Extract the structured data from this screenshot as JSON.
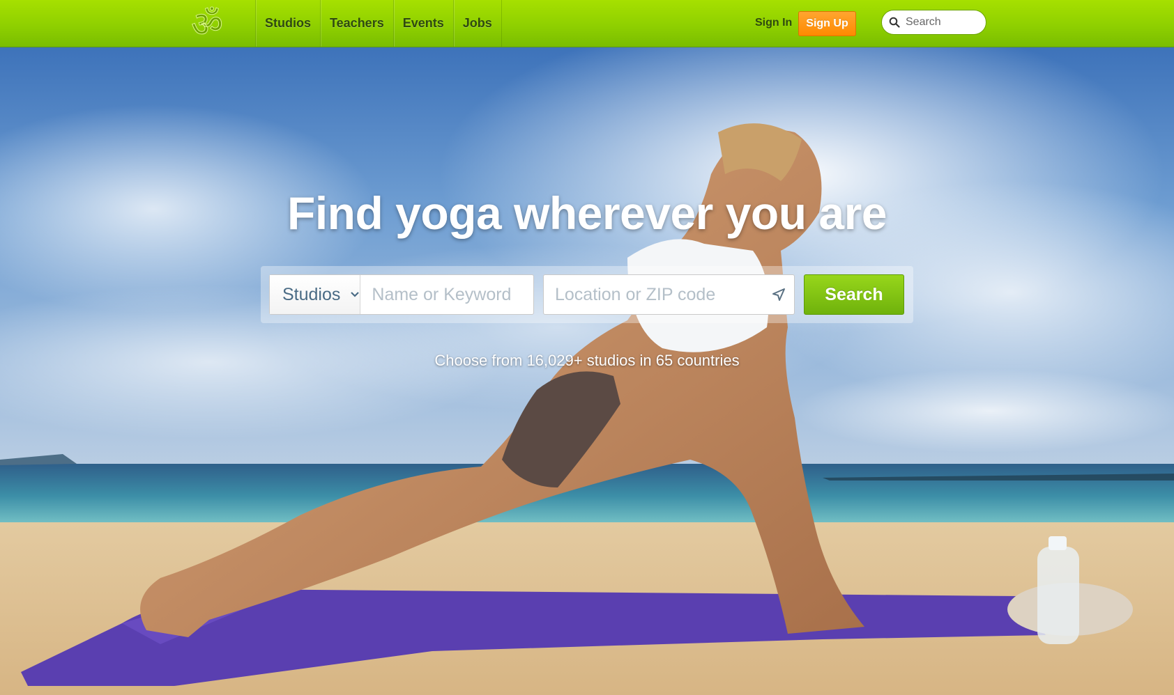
{
  "brand": {
    "logo_icon": "om-symbol-icon",
    "color": "#8fd000"
  },
  "nav": {
    "links": [
      {
        "label": "Studios"
      },
      {
        "label": "Teachers"
      },
      {
        "label": "Events"
      },
      {
        "label": "Jobs"
      }
    ],
    "signin_label": "Sign In",
    "signup_label": "Sign Up",
    "search_placeholder": "Search",
    "search_icon": "search-icon"
  },
  "hero": {
    "headline": "Find yoga wherever you are",
    "type_select_value": "Studios",
    "keyword_placeholder": "Name or Keyword",
    "location_placeholder": "Location or ZIP code",
    "location_icon": "location-arrow-icon",
    "search_button_label": "Search",
    "tagline": "Choose from 16,029+ studios in 65 countries"
  },
  "colors": {
    "signup": "#ff8a00",
    "search_button": "#7fc112",
    "nav_text": "#2f4a10"
  }
}
